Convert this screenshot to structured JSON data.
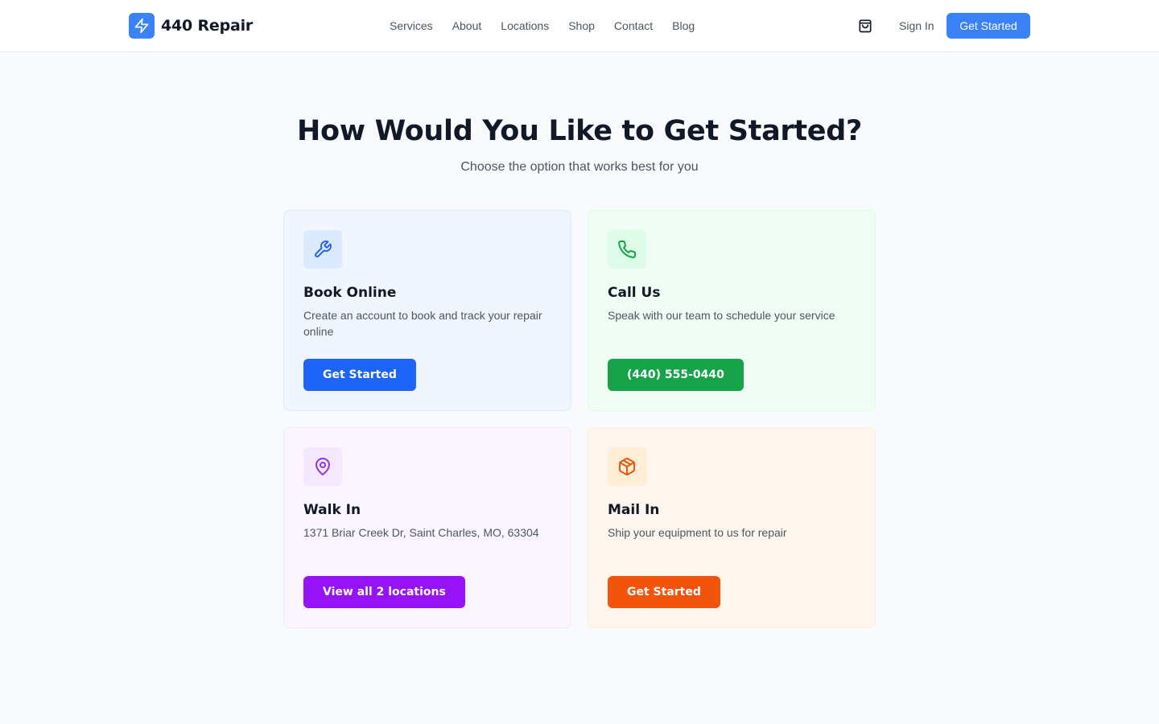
{
  "header": {
    "brand": "440 Repair",
    "nav": [
      "Services",
      "About",
      "Locations",
      "Shop",
      "Contact",
      "Blog"
    ],
    "sign_in": "Sign In",
    "cta": "Get Started"
  },
  "hero": {
    "title": "How Would You Like to Get Started?",
    "subtitle": "Choose the option that works best for you"
  },
  "cards": [
    {
      "icon": "wrench-icon",
      "title": "Book Online",
      "description": "Create an account to book and track your repair online",
      "button": "Get Started",
      "color": "#1d64f8"
    },
    {
      "icon": "phone-icon",
      "title": "Call Us",
      "description": "Speak with our team to schedule your service",
      "button": "(440) 555-0440",
      "color": "#16a34a"
    },
    {
      "icon": "map-pin-icon",
      "title": "Walk In",
      "description": "1371 Briar Creek Dr, Saint Charles, MO, 63304",
      "button": "View all 2 locations",
      "color": "#9513f5"
    },
    {
      "icon": "package-icon",
      "title": "Mail In",
      "description": "Ship your equipment to us for repair",
      "button": "Get Started",
      "color": "#f2540c"
    }
  ],
  "colors": {
    "brand": "#3b82f6",
    "background": "#f8fafc"
  }
}
